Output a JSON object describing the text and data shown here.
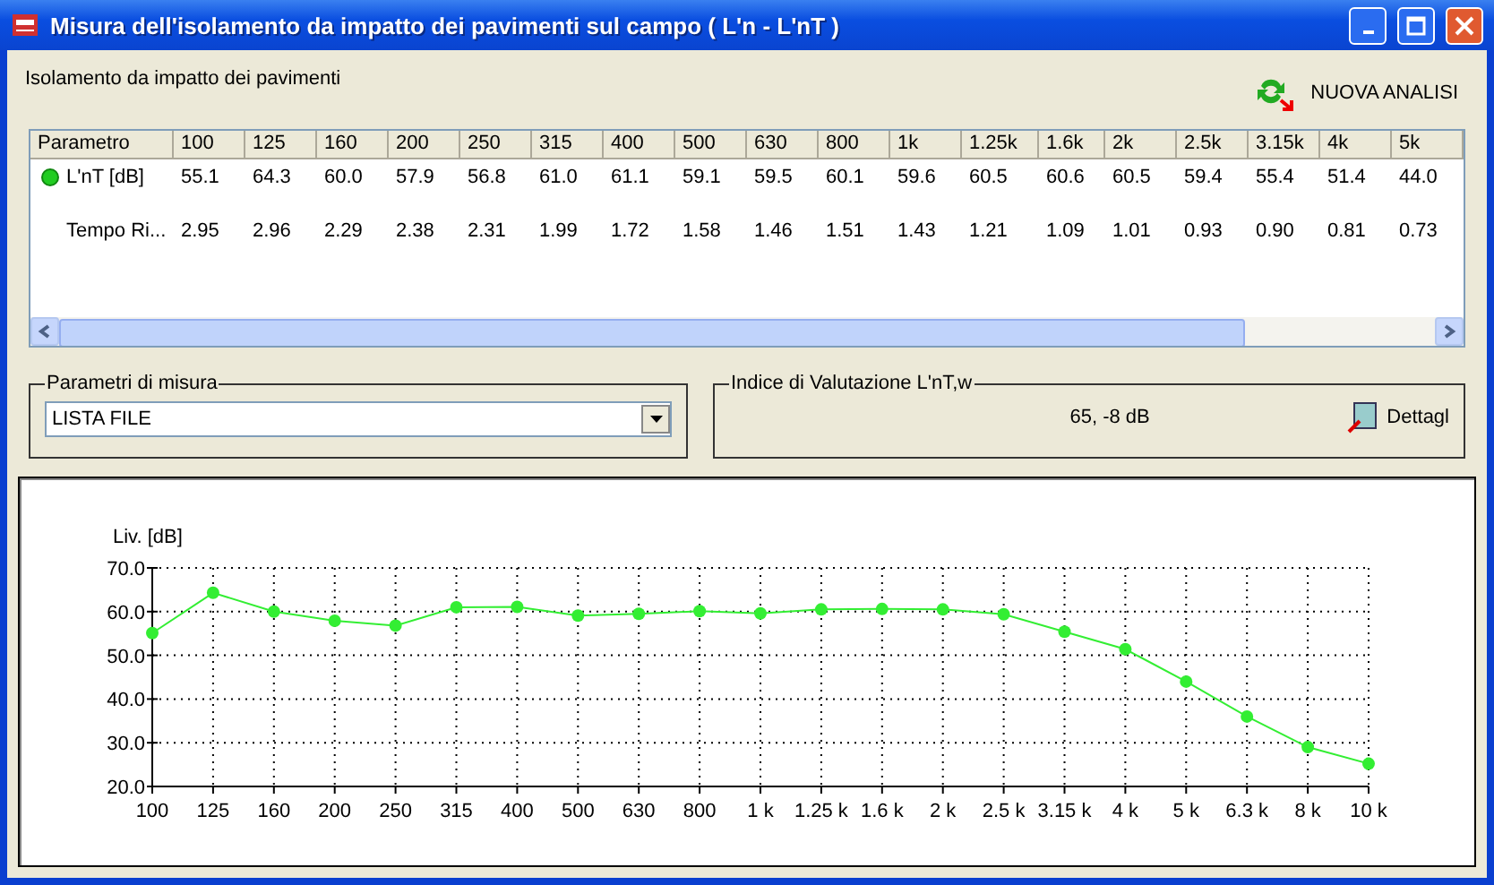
{
  "window": {
    "title": "Misura dell'isolamento da impatto dei pavimenti sul campo ( L'n - L'nT )"
  },
  "section_label": "Isolamento da impatto dei pavimenti",
  "new_analysis_button": "NUOVA ANALISI",
  "table": {
    "columns": [
      "Parametro",
      "100",
      "125",
      "160",
      "200",
      "250",
      "315",
      "400",
      "500",
      "630",
      "800",
      "1k",
      "1.25k",
      "1.6k",
      "2k",
      "2.5k",
      "3.15k",
      "4k",
      "5k"
    ],
    "rows": [
      {
        "marker": true,
        "cells": [
          "L'nT [dB]",
          "55.1",
          "64.3",
          "60.0",
          "57.9",
          "56.8",
          "61.0",
          "61.1",
          "59.1",
          "59.5",
          "60.1",
          "59.6",
          "60.5",
          "60.6",
          "60.5",
          "59.4",
          "55.4",
          "51.4",
          "44.0"
        ]
      },
      {
        "marker": false,
        "cells": [
          "Tempo Ri...",
          "2.95",
          "2.96",
          "2.29",
          "2.38",
          "2.31",
          "1.99",
          "1.72",
          "1.58",
          "1.46",
          "1.51",
          "1.43",
          "1.21",
          "1.09",
          "1.01",
          "0.93",
          "0.90",
          "0.81",
          "0.73"
        ]
      }
    ]
  },
  "parameters_group": {
    "legend": "Parametri di misura",
    "dropdown_value": "LISTA FILE"
  },
  "index_group": {
    "legend": "Indice di Valutazione  L'nT,w",
    "value": "65, -8   dB",
    "details_button": "Dettagl"
  },
  "chart": {
    "chart_data": {
      "type": "line",
      "ylabel": "Liv. [dB]",
      "categories": [
        "100",
        "125",
        "160",
        "200",
        "250",
        "315",
        "400",
        "500",
        "630",
        "800",
        "1 k",
        "1.25 k",
        "1.6 k",
        "2 k",
        "2.5 k",
        "3.15 k",
        "4 k",
        "5 k",
        "6.3 k",
        "8 k",
        "10 k"
      ],
      "grid": true,
      "series": [
        {
          "color": "#33ee33",
          "marker": true,
          "values": [
            55.1,
            64.3,
            60.0,
            57.9,
            56.8,
            61.0,
            61.1,
            59.1,
            59.5,
            60.1,
            59.6,
            60.5,
            60.6,
            60.5,
            59.4,
            55.4,
            51.4,
            44.0,
            36.0,
            29.0,
            25.2
          ]
        }
      ],
      "ylim": [
        20,
        70
      ],
      "yticks": [
        {
          "value": 20,
          "label": "20.0"
        },
        {
          "value": 30,
          "label": "30.0"
        },
        {
          "value": 40,
          "label": "40.0"
        },
        {
          "value": 50,
          "label": "50.0"
        },
        {
          "value": 60,
          "label": "60.0"
        },
        {
          "value": 70,
          "label": "70.0"
        }
      ]
    }
  }
}
